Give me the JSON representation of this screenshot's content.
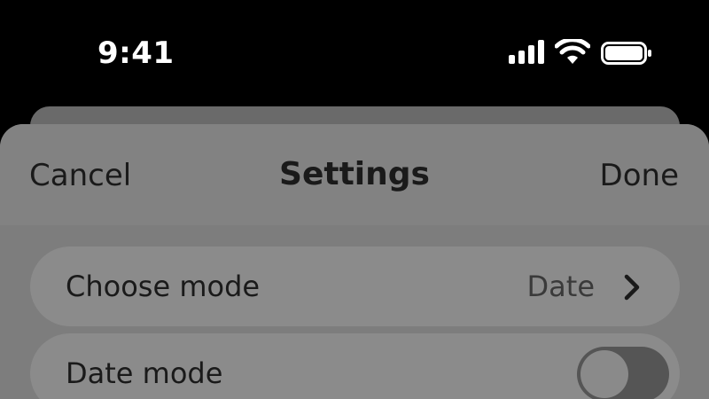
{
  "status_bar": {
    "time": "9:41",
    "icons": [
      "cellular-signal-icon",
      "wifi-icon",
      "battery-icon"
    ]
  },
  "sheet": {
    "nav": {
      "cancel_label": "Cancel",
      "title": "Settings",
      "done_label": "Done"
    },
    "rows": [
      {
        "label": "Choose mode",
        "value": "Date",
        "icon": "chevron-right-icon"
      },
      {
        "label": "Date mode",
        "toggle_on": false
      }
    ]
  },
  "colors": {
    "status_bar_bg": "#000000",
    "sheet_bg": "#7d7d7d",
    "row_bg": "#8b8b8b",
    "text": "#1a1a1a",
    "toggle_track": "#555555"
  }
}
